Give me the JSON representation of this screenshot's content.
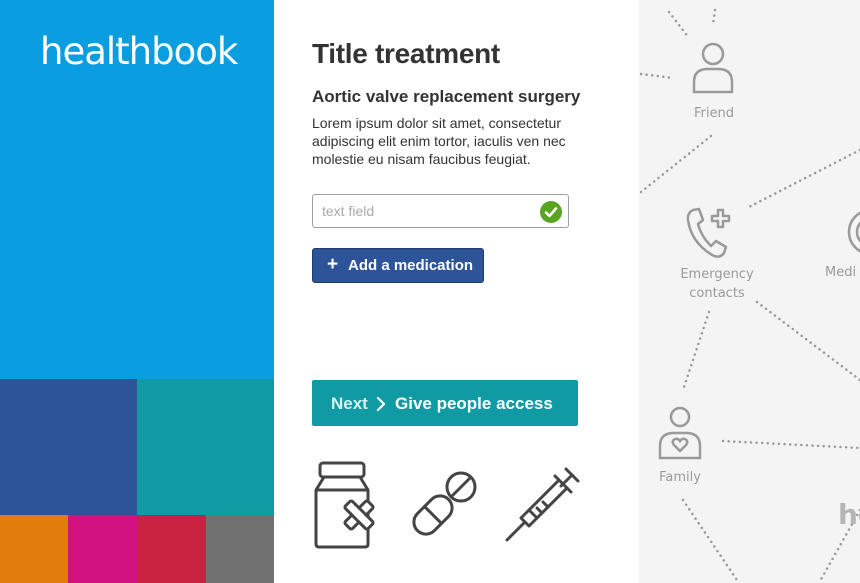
{
  "brand": {
    "logo_text": "healthbook",
    "color": "#0a9ee0",
    "swatches": [
      "#2d5499",
      "#109ba4",
      "#e27d0c",
      "#d2127e",
      "#c8223f",
      "#717171"
    ]
  },
  "content": {
    "title": "Title treatment",
    "subtitle": "Aortic valve replacement surgery",
    "body": "Lorem ipsum dolor sit amet, consectetur adipiscing elit enim tortor, iaculis ven nec molestie eu nisam faucibus feugiat.",
    "text_field": {
      "placeholder": "text field",
      "value": "",
      "valid": true
    },
    "add_button": {
      "label": "Add a medication",
      "icon": "plus-icon"
    },
    "next_button": {
      "prefix": "Next",
      "icon": "chevron-right-icon",
      "label": "Give people access"
    },
    "icons": [
      "medicine-bottle-icon",
      "pills-icon",
      "syringe-icon"
    ]
  },
  "network": {
    "nodes": [
      {
        "label": "Friend",
        "icon": "person-icon"
      },
      {
        "label": "Emergency contacts",
        "line1": "Emergency",
        "line2": "contacts",
        "icon": "phone-plus-icon"
      },
      {
        "label": "Medi",
        "icon": "medical-icon"
      },
      {
        "label": "Family",
        "icon": "person-heart-icon"
      },
      {
        "label": "he"
      }
    ]
  }
}
